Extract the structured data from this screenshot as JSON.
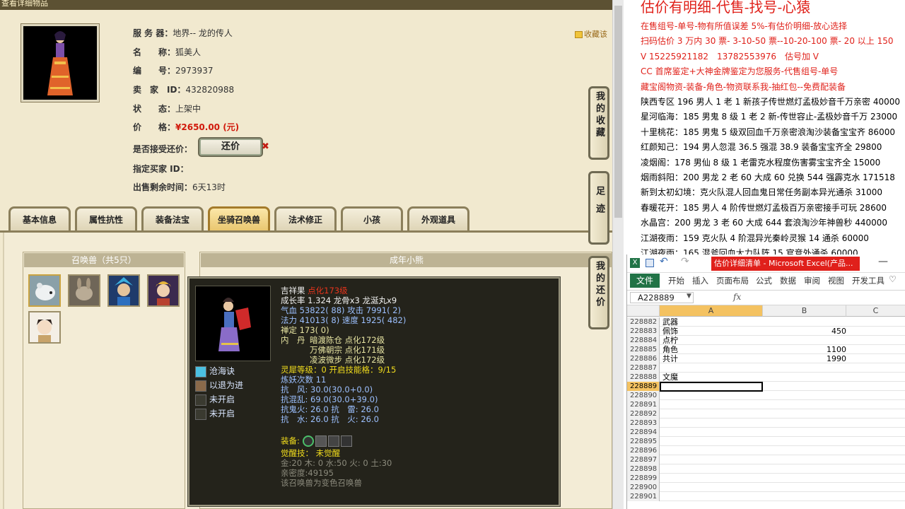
{
  "left": {
    "top_bar": "查看详细物品",
    "item": {
      "server_label": "服 务 器：",
      "server": "地界-- 龙的传人",
      "name_label": "名　　称：",
      "name": "狐美人",
      "id_label": "编　　号：",
      "id": "2973937",
      "seller_label": "卖　家　ID：",
      "seller": "432820988",
      "status_label": "状　　态：",
      "status": "上架中",
      "price_label": "价　　格：",
      "price": "¥2650.00 (元)",
      "bargain_label": "是否接受还价：",
      "bargain_button": "还价",
      "bargain_close": "✖",
      "buyer_label": "指定买家 ID：",
      "buyer": "",
      "remaining_label": "出售剩余时间：",
      "remaining": "6天13时"
    },
    "favorite_link": "收藏该",
    "tabs": [
      "基本信息",
      "属性抗性",
      "装备法宝",
      "坐骑召唤兽",
      "法术修正",
      "小孩",
      "外观道具"
    ],
    "summon_header": "召唤兽（共5只）",
    "grow_header": "成年小熊",
    "side_buttons": [
      "我的收藏",
      "足迹",
      "我的还价"
    ]
  },
  "tooltip": {
    "name": "吉祥果",
    "name_suffix": "点化173级",
    "growth": "成长率 1.324 龙骨x3 龙涎丸x9",
    "hp": "气血 53822( 88) 攻击 7991( 2)",
    "mp": "法力 41013( 8) 速度 1925( 482)",
    "ding": "禅定 173( 0)",
    "neidan_label": "内　丹",
    "neidan": [
      "暗渡陈仓 点化172级",
      "万佛朝宗 点化171级",
      "凌波微步 点化172级"
    ],
    "lingxi": "灵犀等级：0 开启技能格：9/15",
    "lianyao": "炼妖次数 11",
    "res1": "抗　风: 30.0(30.0+0.0)",
    "res2": "抗混乱: 69.0(30.0+39.0)",
    "res3": "抗鬼火: 26.0 抗　雷: 26.0",
    "res4": "抗　水: 26.0 抗　火: 26.0",
    "equip_label": "装备:",
    "awaken": "觉醒技： 未觉醒",
    "elements": "金:20 木: 0 水:50 火: 0 土:30",
    "intimacy": "亲密度:49195",
    "note": "该召唤兽为变色召唤兽",
    "skills": [
      "沧海诀",
      "以退为进",
      "未开启",
      "未开启"
    ]
  },
  "right": {
    "title": "估价有明细-代售-找号-心猿",
    "lines": [
      {
        "text": "在售组号-单号-物有所值误差 5%-有估价明细-放心选择",
        "color": "#e0211a"
      },
      {
        "text": "扫码估价 3 万内 30 票- 3-10-50 票--10-20-100 票- 20 以上 150",
        "color": "#e0211a"
      },
      {
        "text": "V 15225921182　13782553976　估号加 V",
        "color": "#e0211a"
      },
      {
        "text": "CC 首席鉴定+大神金牌鉴定为您服务-代售组号-单号",
        "color": "#e0211a"
      },
      {
        "text": "藏宝阁物资-装备-角色-物资联系我-抽红包--免费配装备",
        "color": "#e0211a"
      },
      {
        "text": "陕西专区 196 男人 1 老 1 新孩子传世燃灯孟极妙音千万亲密 40000",
        "color": "#000000"
      },
      {
        "text": "星河临海：185 男鬼 8 级 1 老 2 新-传世容止-孟极妙音千万 23000",
        "color": "#000000"
      },
      {
        "text": "十里桃花：185 男鬼 5 级双回血千万亲密浪淘沙装备宝宝齐 86000",
        "color": "#000000"
      },
      {
        "text": "红颜知己：194 男人忽混 36.5 强混 38.9 装备宝宝齐全 29800",
        "color": "#000000"
      },
      {
        "text": "凌烟阁：178 男仙 8 级 1 老雷克水程度伤害雾宝宝齐全 15000",
        "color": "#000000"
      },
      {
        "text": "烟雨斜阳：200 男龙 2 老 60 大成 60 兑换 544 强霹克水 171518",
        "color": "#000000"
      },
      {
        "text": "新到太初幻境：克火队混人回血鬼日常任务副本异光通杀 31000",
        "color": "#000000"
      },
      {
        "text": "春暖花开：185 男人 4 阶传世燃灯孟极百万亲密接手可玩 28600",
        "color": "#000000"
      },
      {
        "text": "水晶宫：200 男龙 3 老 60 大成 644 套浪淘沙年神兽秒 440000",
        "color": "#000000"
      },
      {
        "text": "江湖夜雨：159 克火队 4 阶混异光秦岭灵猴 14 通杀 60000",
        "color": "#000000"
      },
      {
        "text": "江湖夜雨：165 混斧回血大力队阵 15 官竞外通杀 60000",
        "color": "#000000"
      }
    ]
  },
  "excel": {
    "title": "估价详细清单 - Microsoft Excel(产品...",
    "file": "文件",
    "menus": [
      "开始",
      "插入",
      "页面布局",
      "公式",
      "数据",
      "审阅",
      "视图",
      "开发工具"
    ],
    "namebox": "A228889",
    "fx": "fx",
    "columns": [
      "A",
      "B",
      "C"
    ],
    "rows": [
      {
        "n": "228882",
        "a": "武器",
        "b": ""
      },
      {
        "n": "228883",
        "a": "佩饰",
        "b": "450"
      },
      {
        "n": "228884",
        "a": "点柠",
        "b": ""
      },
      {
        "n": "228885",
        "a": "角色",
        "b": "1100"
      },
      {
        "n": "228886",
        "a": "共计",
        "b": "1990"
      },
      {
        "n": "228887",
        "a": "",
        "b": ""
      },
      {
        "n": "228888",
        "a": "文魔",
        "b": ""
      },
      {
        "n": "228889",
        "a": "",
        "b": ""
      },
      {
        "n": "228890",
        "a": "",
        "b": ""
      },
      {
        "n": "228891",
        "a": "",
        "b": ""
      },
      {
        "n": "228892",
        "a": "",
        "b": ""
      },
      {
        "n": "228893",
        "a": "",
        "b": ""
      },
      {
        "n": "228894",
        "a": "",
        "b": ""
      },
      {
        "n": "228895",
        "a": "",
        "b": ""
      },
      {
        "n": "228896",
        "a": "",
        "b": ""
      },
      {
        "n": "228897",
        "a": "",
        "b": ""
      },
      {
        "n": "228898",
        "a": "",
        "b": ""
      },
      {
        "n": "228899",
        "a": "",
        "b": ""
      },
      {
        "n": "228900",
        "a": "",
        "b": ""
      },
      {
        "n": "228901",
        "a": "",
        "b": ""
      }
    ]
  }
}
